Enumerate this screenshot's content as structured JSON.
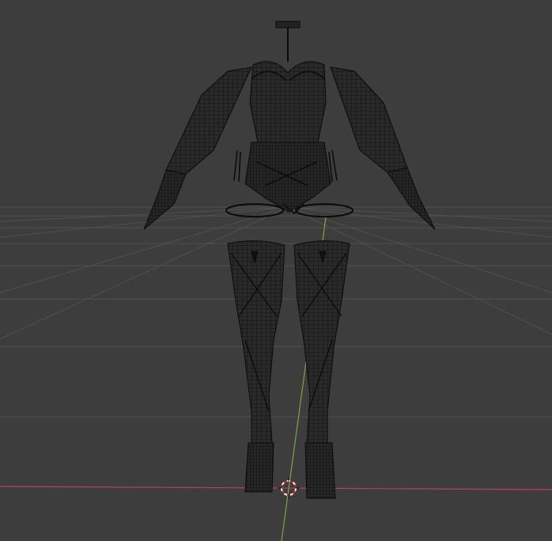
{
  "viewport": {
    "background": "#3d3d3d",
    "grid_color": "#555555",
    "x_axis_color": "#b9434e",
    "y_axis_color": "#78a83c",
    "wireframe_color": "#0a0a0a",
    "cursor_colors": [
      "#cc2222",
      "#ffffff"
    ]
  },
  "scene": {
    "objects": [
      "outfit-top-mesh",
      "stocking-left-mesh",
      "stocking-right-mesh"
    ],
    "tool": "3d-cursor"
  }
}
